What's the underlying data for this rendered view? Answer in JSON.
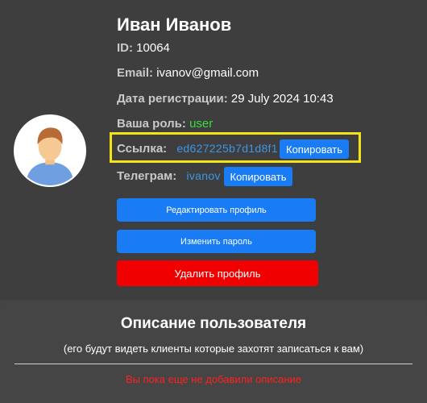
{
  "profile": {
    "name": "Иван Иванов",
    "id_label": "ID:",
    "id_value": "10064",
    "email_label": "Email:",
    "email_value": "ivanov@gmail.com",
    "reg_label": "Дата регистрации:",
    "reg_value": "29 July 2024 10:43",
    "role_label": "Ваша роль:",
    "role_value": "user",
    "link_label": "Ссылка:",
    "link_value": "ed627225b7d1d8f1",
    "link_copy_label": "Копировать",
    "telegram_label": "Телеграм:",
    "telegram_value": "ivanov",
    "telegram_copy_label": "Копировать",
    "avatar_icon": "user-avatar-icon"
  },
  "actions": {
    "edit_label": "Редактировать профиль",
    "password_label": "Изменить пароль",
    "delete_label": "Удалить профиль"
  },
  "description": {
    "title": "Описание пользователя",
    "subtitle": "(его будут видеть клиенты которые захотят записаться к вам)",
    "empty_text": "Вы пока еще не добавили описание"
  },
  "colors": {
    "background": "#3e3e3e",
    "accent_blue": "#1a7cf5",
    "danger_red": "#f00000",
    "role_green": "#3ddb3d",
    "highlight_yellow": "#f5e31a",
    "empty_text_red": "#ff2020"
  }
}
